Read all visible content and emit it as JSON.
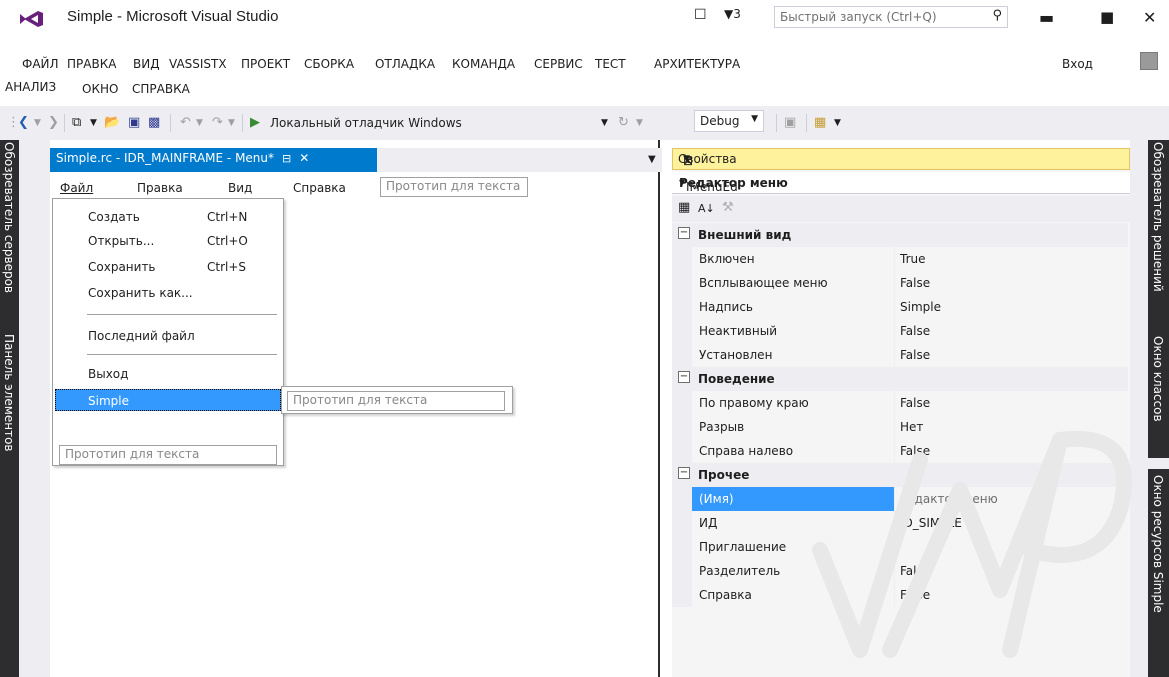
{
  "titlebar": {
    "title": "Simple - Microsoft Visual Studio",
    "notification_count": "3",
    "quick_launch_placeholder": "Быстрый запуск (Ctrl+Q)"
  },
  "menubar": {
    "items": [
      "ФАЙЛ",
      "ПРАВКА",
      "ВИД",
      "VASSISTX",
      "ПРОЕКТ",
      "СБОРКА",
      "ОТЛАДКА",
      "КОМАНДА",
      "СЕРВИС",
      "ТЕСТ",
      "АРХИТЕКТУРА"
    ],
    "items_row2": [
      "АНАЛИЗ",
      "ОКНО",
      "СПРАВКА"
    ],
    "login": "Вход"
  },
  "toolbar": {
    "debugger_label": "Локальный отладчик Windows",
    "config": "Debug"
  },
  "left_panels": [
    "Обозреватель серверов",
    "Панель элементов"
  ],
  "right_panels": [
    "Обозреватель решений",
    "Окно классов",
    "Окно ресурсов Simple"
  ],
  "document": {
    "tab_label": "Simple.rc - IDR_MAINFRAME - Menu*",
    "menu_bar": [
      "Файл",
      "Правка",
      "Вид",
      "Справка"
    ],
    "prototype_text": "Прототип для текста",
    "dropdown": {
      "items": [
        {
          "label": "Создать",
          "shortcut": "Ctrl+N"
        },
        {
          "label": "Открыть...",
          "shortcut": "Ctrl+O"
        },
        {
          "label": "Сохранить",
          "shortcut": "Ctrl+S"
        },
        {
          "label": "Сохранить как...",
          "shortcut": ""
        },
        {
          "label": "Последний файл",
          "shortcut": ""
        },
        {
          "label": "Выход",
          "shortcut": ""
        },
        {
          "label": "Simple",
          "shortcut": ""
        }
      ],
      "prototype_bottom": "Прототип для текста",
      "submenu_prototype": "Прототип для текста"
    }
  },
  "properties": {
    "title": "Свойства",
    "object_name": "Редактор меню",
    "object_type": "IMenuEd",
    "categories": [
      {
        "name": "Внешний вид",
        "rows": [
          {
            "name": "Включен",
            "value": "True"
          },
          {
            "name": "Всплывающее меню",
            "value": "False"
          },
          {
            "name": "Надпись",
            "value": "Simple"
          },
          {
            "name": "Неактивный",
            "value": "False"
          },
          {
            "name": "Установлен",
            "value": "False"
          }
        ]
      },
      {
        "name": "Поведение",
        "rows": [
          {
            "name": "По правому краю",
            "value": "False"
          },
          {
            "name": "Разрыв",
            "value": "Нет"
          },
          {
            "name": "Справа налево",
            "value": "False"
          }
        ]
      },
      {
        "name": "Прочее",
        "rows": [
          {
            "name": "(Имя)",
            "value": "Редактор меню"
          },
          {
            "name": "ИД",
            "value": "ID_SIMPLE"
          },
          {
            "name": "Приглашение",
            "value": ""
          },
          {
            "name": "Разделитель",
            "value": "False"
          },
          {
            "name": "Справка",
            "value": "False"
          }
        ]
      }
    ]
  },
  "watermark_text": "УМР",
  "colors": {
    "accent_blue": "#007acc",
    "selection_blue": "#3399ff",
    "active_yellow": "#fff29d",
    "dark_panel": "#2d2d30",
    "vs_purple": "#68217a"
  }
}
